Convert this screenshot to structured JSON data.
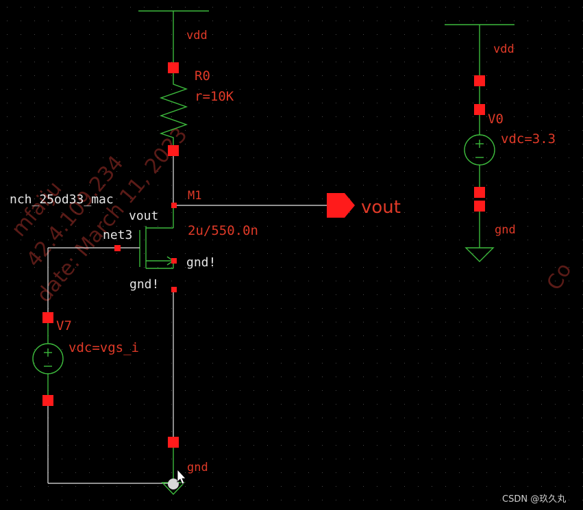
{
  "colors": {
    "background": "#000000",
    "wire": "#e8e8e8",
    "symbol": "#3dbb3d",
    "pin": "#ff1b1b",
    "label": "#e03a28",
    "text": "#e6e6e6",
    "watermark": "#c83c32"
  },
  "resistor": {
    "net_top": "vdd",
    "name": "R0",
    "value": "r=10K"
  },
  "transistor": {
    "name": "M1",
    "model": "nch_25od33_mac",
    "size": "2u/550.0n",
    "drain_net": "vout",
    "gate_net": "net3",
    "body_net": "gnd!",
    "source_net": "gnd!"
  },
  "output_pin": {
    "label": "vout",
    "icon": "output-pin-icon"
  },
  "gate_source": {
    "name": "V7",
    "value": "vdc=vgs_i"
  },
  "ground_label": "gnd",
  "supply_source": {
    "net_top": "vdd",
    "name": "V0",
    "value": "vdc=3.3",
    "net_bottom": "gnd"
  },
  "watermark": {
    "line1": "mfaiju",
    "line2": "42.4.109.234",
    "line3": "date: March 11, 2023",
    "line4": "Co"
  },
  "credit": "CSDN @玖久丸"
}
